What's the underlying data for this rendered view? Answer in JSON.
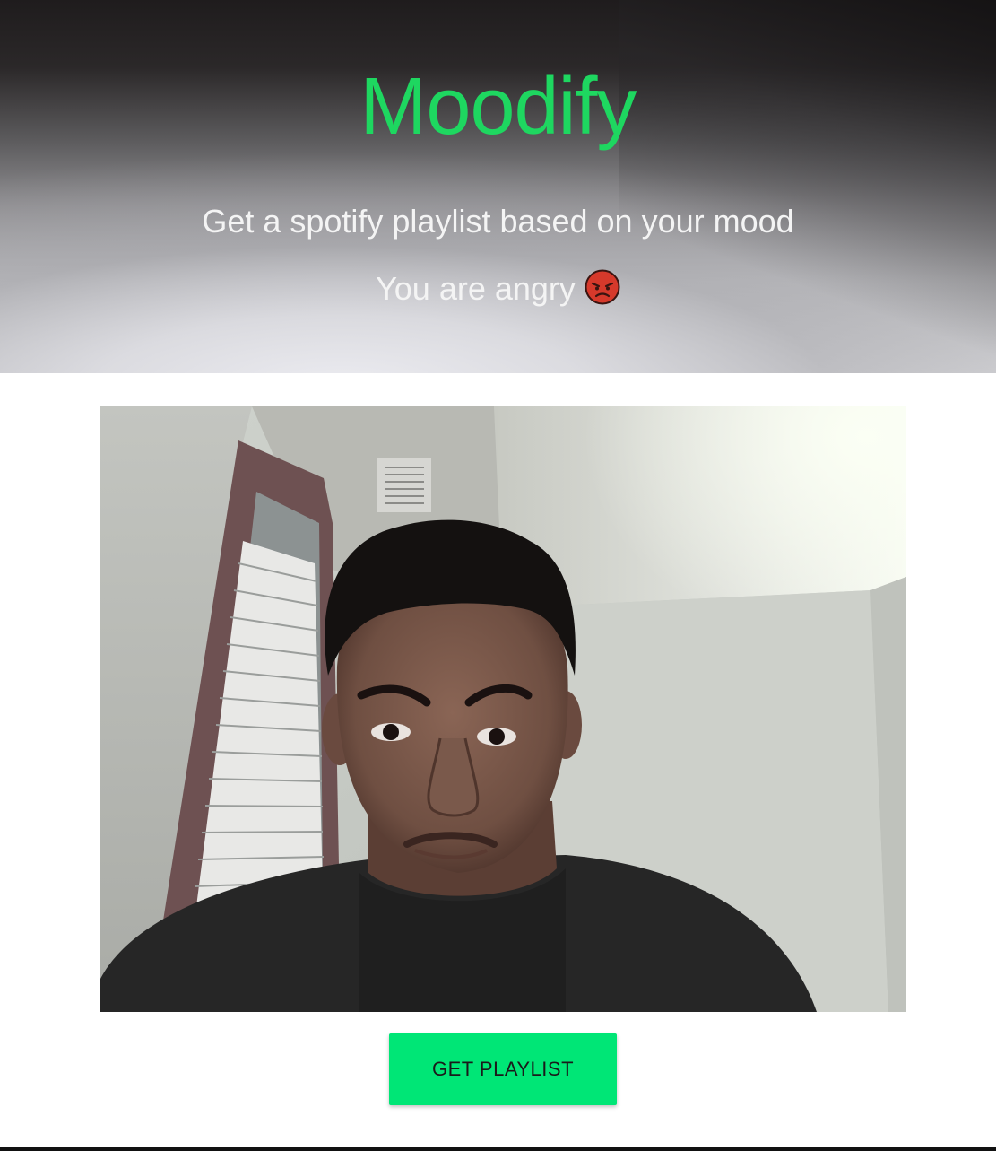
{
  "app": {
    "title": "Moodify",
    "subtitle": "Get a spotify playlist based on your mood",
    "mood_text": "You are angry",
    "mood_icon": "angry-face-emoji"
  },
  "actions": {
    "get_playlist_label": "GET PLAYLIST"
  },
  "colors": {
    "brand_green": "#1ed760",
    "button_green": "#00e676",
    "hero_dark": "#1f1c1d",
    "hero_light": "#d6d6d9",
    "emoji_red": "#d6392b"
  }
}
